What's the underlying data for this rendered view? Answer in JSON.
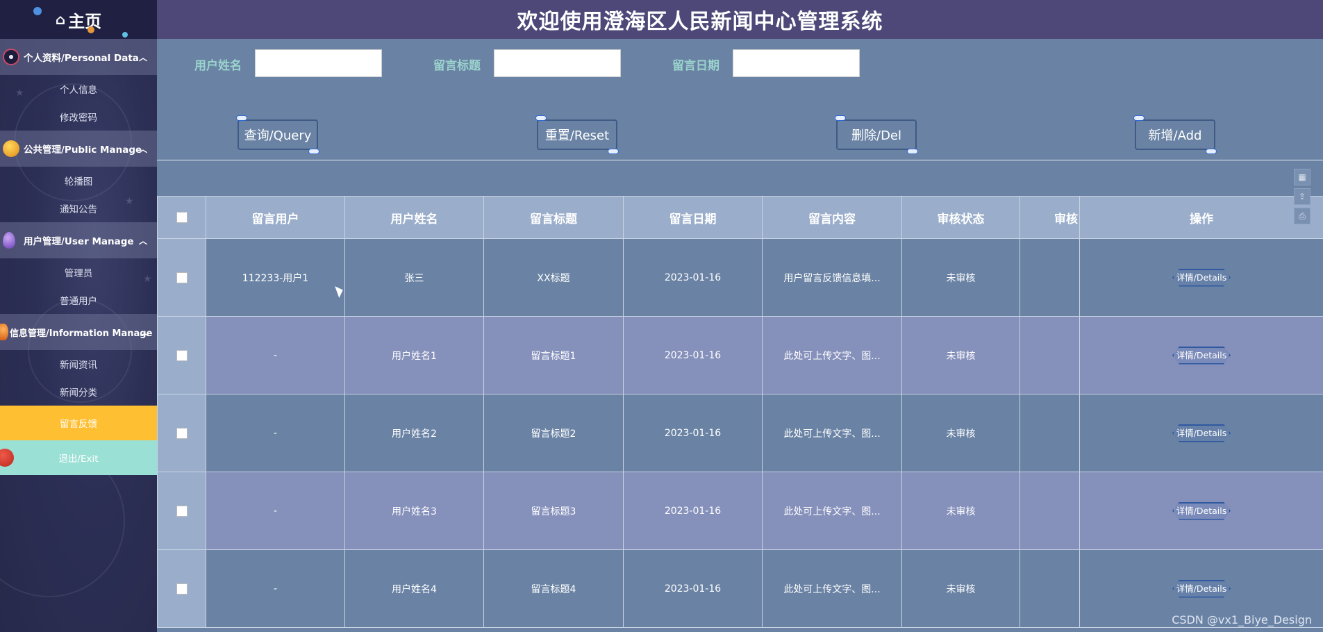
{
  "app": {
    "title": "欢迎使用澄海区人民新闻中心管理系统",
    "watermark": "CSDN @vx1_Biye_Design"
  },
  "sidebar": {
    "home_label": "主页",
    "groups": [
      {
        "label": "个人资料/Personal Data",
        "items": [
          "个人信息",
          "修改密码"
        ]
      },
      {
        "label": "公共管理/Public Manage",
        "items": [
          "轮播图",
          "通知公告"
        ]
      },
      {
        "label": "用户管理/User Manage",
        "items": [
          "管理员",
          "普通用户"
        ]
      },
      {
        "label": "信息管理/Information Manage",
        "items": [
          "新闻资讯",
          "新闻分类"
        ]
      }
    ],
    "active_item": "留言反馈",
    "exit_label": "退出/Exit"
  },
  "search": {
    "user_name_label": "用户姓名",
    "title_label": "留言标题",
    "date_label": "留言日期",
    "user_name_value": "",
    "title_value": "",
    "date_value": ""
  },
  "buttons": {
    "query": "查询/Query",
    "reset": "重置/Reset",
    "delete": "删除/Del",
    "add": "新增/Add"
  },
  "table": {
    "columns": [
      "留言用户",
      "用户姓名",
      "留言标题",
      "留言日期",
      "留言内容",
      "审核状态",
      "审核",
      "操作"
    ],
    "details_label": "详情/Details",
    "rows": [
      {
        "user": "112233-用户1",
        "name": "张三",
        "title": "XX标题",
        "date": "2023-01-16",
        "content": "用户留言反馈信息填...",
        "status": "未审核",
        "audit": ""
      },
      {
        "user": "-",
        "name": "用户姓名1",
        "title": "留言标题1",
        "date": "2023-01-16",
        "content": "此处可上传文字、图...",
        "status": "未审核",
        "audit": ""
      },
      {
        "user": "-",
        "name": "用户姓名2",
        "title": "留言标题2",
        "date": "2023-01-16",
        "content": "此处可上传文字、图...",
        "status": "未审核",
        "audit": ""
      },
      {
        "user": "-",
        "name": "用户姓名3",
        "title": "留言标题3",
        "date": "2023-01-16",
        "content": "此处可上传文字、图...",
        "status": "未审核",
        "audit": ""
      },
      {
        "user": "-",
        "name": "用户姓名4",
        "title": "留言标题4",
        "date": "2023-01-16",
        "content": "此处可上传文字、图...",
        "status": "未审核",
        "audit": ""
      }
    ]
  },
  "colors": {
    "sidebar_bg": "#2c2f55",
    "header_bg": "#4d4878",
    "content_bg": "#6a83a4",
    "active_item": "#ffbf33",
    "exit_item": "#9be0d4",
    "label_color": "#9bd3cd",
    "row_alt": "#8590bb"
  },
  "icons": [
    "home-icon",
    "atom-icon",
    "planet-icon",
    "gem-icon",
    "orange-planet-icon",
    "red-planet-icon",
    "grid-icon",
    "export-icon",
    "print-icon"
  ]
}
